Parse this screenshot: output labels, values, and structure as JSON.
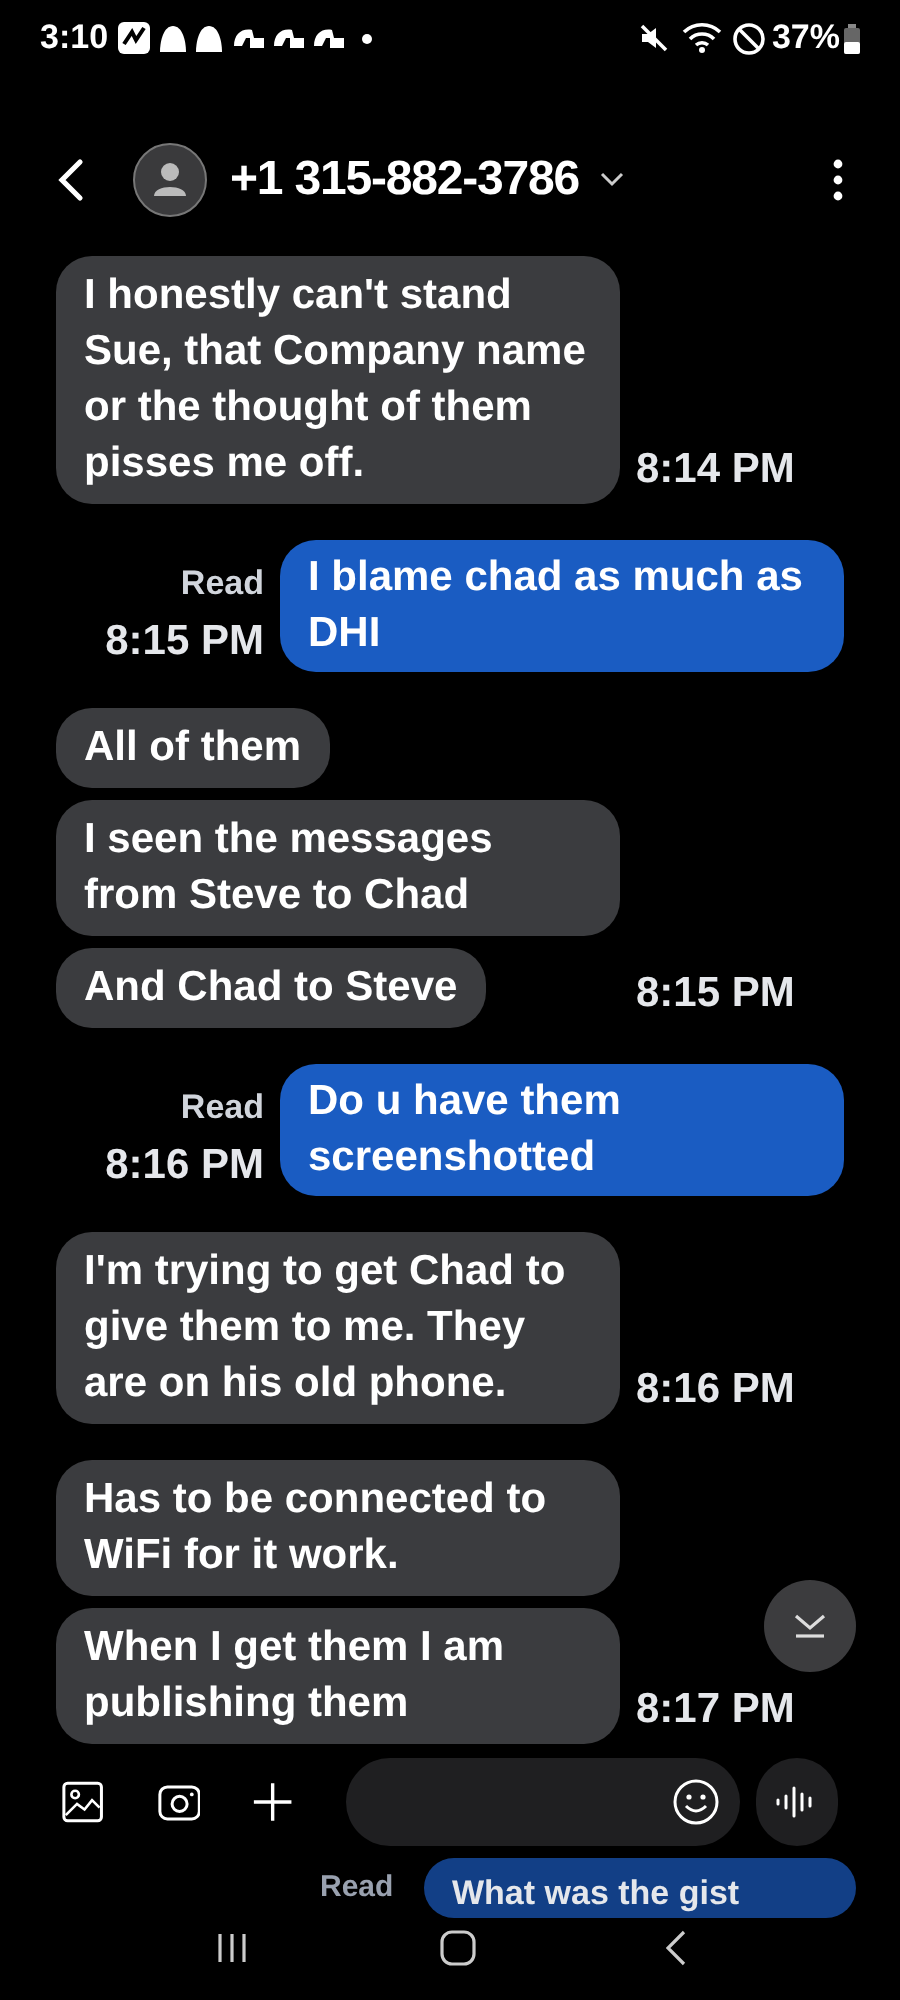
{
  "status_bar": {
    "time": "3:10",
    "battery": "37%"
  },
  "header": {
    "contact": "+1 315-882-3786"
  },
  "messages": [
    {
      "kind": "incoming",
      "bubbles": [
        "I honestly can't stand Sue, that Company name or the thought of them pisses me off."
      ],
      "time": "8:14 PM"
    },
    {
      "kind": "outgoing",
      "status": "Read",
      "bubbles": [
        "I blame chad as much as DHI"
      ],
      "time": "8:15 PM"
    },
    {
      "kind": "incoming",
      "bubbles": [
        "All of them",
        "I seen the messages from Steve to Chad",
        "And Chad to Steve"
      ],
      "time": "8:15 PM"
    },
    {
      "kind": "outgoing",
      "status": "Read",
      "bubbles": [
        "Do u have them screenshotted"
      ],
      "time": "8:16 PM"
    },
    {
      "kind": "incoming",
      "bubbles": [
        "I'm trying to get Chad to give them to me. They are on his old phone."
      ],
      "time": "8:16 PM"
    },
    {
      "kind": "incoming",
      "bubbles": [
        "Has to be connected to WiFi for it work.",
        "When I get them I am publishing them"
      ],
      "time": "8:17 PM"
    }
  ],
  "hidden_message": {
    "status": "Read",
    "text": "What was the gist"
  }
}
